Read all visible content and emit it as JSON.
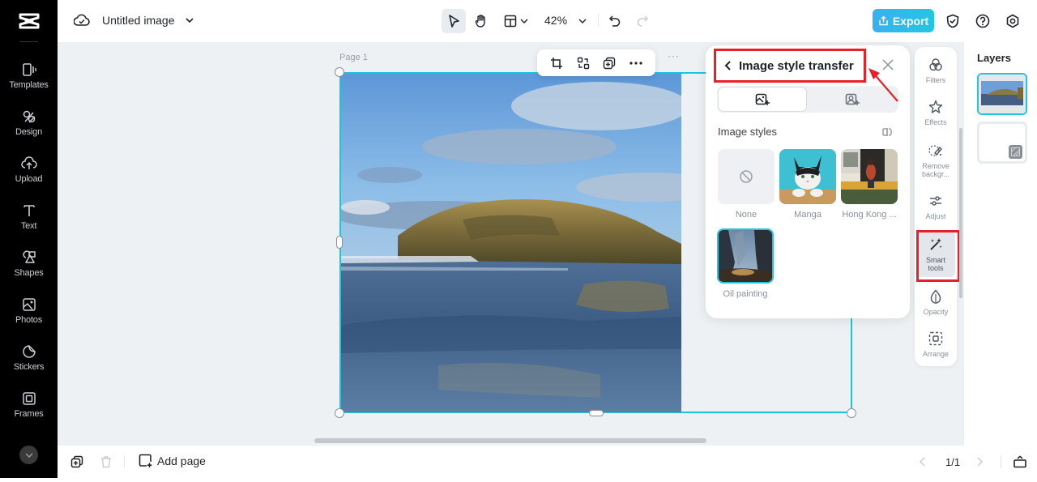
{
  "app": {
    "document_title": "Untitled image"
  },
  "sidebar": {
    "items": [
      {
        "label": "Templates",
        "icon": "templates-icon"
      },
      {
        "label": "Design",
        "icon": "design-icon"
      },
      {
        "label": "Upload",
        "icon": "upload-icon"
      },
      {
        "label": "Text",
        "icon": "text-icon"
      },
      {
        "label": "Shapes",
        "icon": "shapes-icon"
      },
      {
        "label": "Photos",
        "icon": "photos-icon"
      },
      {
        "label": "Stickers",
        "icon": "stickers-icon"
      },
      {
        "label": "Frames",
        "icon": "frames-icon"
      }
    ]
  },
  "toolbar": {
    "zoom_level": "42%",
    "export_label": "Export"
  },
  "canvas": {
    "page_label": "Page 1",
    "page_more": "···"
  },
  "panel": {
    "title": "Image style transfer",
    "section_label": "Image styles",
    "styles": [
      {
        "name": "None",
        "selected": false
      },
      {
        "name": "Manga",
        "selected": false
      },
      {
        "name": "Hong Kong ...",
        "selected": false
      },
      {
        "name": "Oil painting",
        "selected": true
      }
    ]
  },
  "right_tools": {
    "items": [
      {
        "label": "Filters",
        "icon": "filters-icon"
      },
      {
        "label": "Effects",
        "icon": "effects-icon"
      },
      {
        "label": "Remove backgr...",
        "icon": "remove-background-icon"
      },
      {
        "label": "Adjust",
        "icon": "adjust-icon"
      },
      {
        "label": "Smart tools",
        "icon": "smart-tools-icon",
        "active": true
      },
      {
        "label": "Opacity",
        "icon": "opacity-icon"
      },
      {
        "label": "Arrange",
        "icon": "arrange-icon"
      }
    ]
  },
  "layers": {
    "title": "Layers"
  },
  "bottombar": {
    "add_page_label": "Add page",
    "page_count": "1/1"
  },
  "colors": {
    "accent": "#23c4de",
    "highlight_annotation": "#e8202a",
    "sidebar_bg": "#000000"
  }
}
